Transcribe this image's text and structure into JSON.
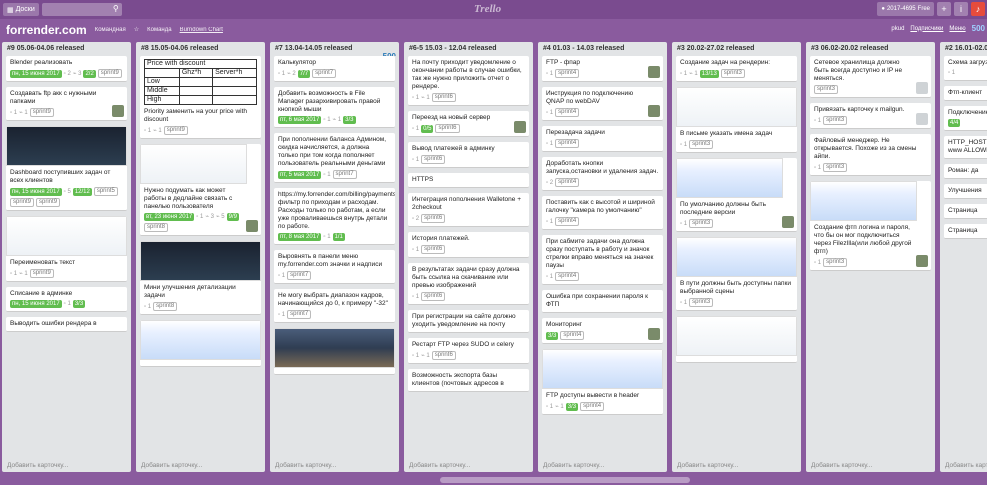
{
  "topbar": {
    "boards_label": "Доски",
    "logo": "Trello",
    "account": "2017-4695",
    "account_tag": "Free",
    "badge_new": "New"
  },
  "board": {
    "title": "forrender.com",
    "visibility": "Командная",
    "team": "Команда",
    "powerup": "Burndown Chart",
    "pups": "pkud",
    "subscribe": "Подписчики",
    "menu": "Меню",
    "total": "500"
  },
  "lists": [
    {
      "title": "#9 05.06-04.06 released",
      "num": "",
      "cards": [
        {
          "text": "Blender реализовать",
          "due": "пн, 15 июня 2017",
          "check": "2/2",
          "labels": [
            "sprint9"
          ],
          "counts": [
            "2",
            "3"
          ]
        },
        {
          "text": "Создавать ftp акк с нужными папками",
          "labels": [
            "sprint9"
          ],
          "counts": [
            "1",
            "1"
          ],
          "avatar": true
        },
        {
          "img": "dark",
          "text": "Dashboard поступивших задач от всех клиентов",
          "due": "пн, 15 июня 2017",
          "check": "12/12",
          "labels": [
            "sprint5",
            "sprint9",
            "sprint9"
          ],
          "counts": [
            "5"
          ]
        },
        {
          "img": "plain",
          "text": "Переименовать текст",
          "labels": [
            "sprint9"
          ],
          "counts": [
            "1",
            "1"
          ]
        },
        {
          "text": "Списание в админке",
          "due": "пн, 15 июня 2017",
          "check": "3/3",
          "labels": [],
          "counts": [
            "1"
          ]
        },
        {
          "text": "Выводить ошибки рендера в",
          "labels": [],
          "counts": []
        }
      ],
      "add": "Добавить карточку..."
    },
    {
      "title": "#8 15.05-04.06 released",
      "num": "",
      "cards": [
        {
          "table": true,
          "text": "Priority заменить на your price with discount",
          "labels": [
            "sprint9"
          ],
          "counts": [
            "1",
            "1"
          ]
        },
        {
          "img": "plain",
          "text": "Нужно подумать как может работы в дедлайне связать с панелью пользователя",
          "due": "вт, 23 июня 2017",
          "check": "9/9",
          "labels": [
            "sprint8"
          ],
          "counts": [
            "1",
            "3",
            "5"
          ],
          "avatar": true
        },
        {
          "img": "dark",
          "text": "Мини улучшения детализации задачи",
          "labels": [
            "sprint8"
          ],
          "counts": [
            "1"
          ]
        },
        {
          "img": "blue",
          "text": "",
          "labels": [],
          "counts": []
        }
      ],
      "add": "Добавить карточку..."
    },
    {
      "title": "#7 13.04-14.05 released",
      "num": "500",
      "cards": [
        {
          "text": "Калькулятор",
          "check": "7/7",
          "labels": [
            "sprint7"
          ],
          "counts": [
            "1",
            "2"
          ]
        },
        {
          "text": "Добавить возможность в File Manager разархивировать правой кнопкой мыши",
          "due": "пт, 6 мая 2017",
          "check": "3/3",
          "labels": [],
          "counts": [
            "1",
            "1"
          ]
        },
        {
          "text": "При пополнении баланса Админом, скидка начисляется, а должна только при том когда пополняет пользователь реальными деньгами",
          "due": "пт, 5 мая 2017",
          "labels": [
            "sprint7"
          ],
          "counts": [
            "1"
          ]
        },
        {
          "text": "https://my.forrender.com/billing/payments/ фильтр по приходам и расходам. Расходы только по работам, а если уже проваливаешься внутрь детали по работе.",
          "due": "пт, 8 мая 2017",
          "check": "1/1",
          "labels": [],
          "counts": [
            "1"
          ]
        },
        {
          "text": "Выровнять в панели меню my.forrender.com значки и надписи",
          "labels": [
            "sprint7"
          ],
          "counts": [
            "1"
          ]
        },
        {
          "text": "Не могу выбрать диапазон кадров, начинающийся до 0, к примеру \"-32\"",
          "labels": [
            "sprint7"
          ],
          "counts": [
            "1"
          ]
        },
        {
          "img": "photo",
          "text": "",
          "labels": [],
          "counts": []
        }
      ],
      "add": "Добавить карточку..."
    },
    {
      "title": "#6-5 15.03 - 12.04 released",
      "num": "",
      "cards": [
        {
          "text": "На почту приходит уведомление о окончании работы в случае ошибки, так же нужно приложить отчет о рендере.",
          "labels": [
            "sprint6"
          ],
          "counts": [
            "1",
            "1"
          ]
        },
        {
          "text": "Переезд на новый сервер",
          "check": "0/5",
          "labels": [
            "sprint6"
          ],
          "counts": [
            "1"
          ],
          "avatar": true
        },
        {
          "text": "Вывод платежей в админку",
          "labels": [
            "sprint6"
          ],
          "counts": [
            "1"
          ]
        },
        {
          "text": "HTTPS",
          "labels": [],
          "counts": []
        },
        {
          "text": "Интеграция пополнения Walletone + 2checkout",
          "labels": [
            "sprint6"
          ],
          "counts": [
            "2"
          ]
        },
        {
          "text": "История платежей.",
          "labels": [
            "sprint6"
          ],
          "counts": [
            "1"
          ]
        },
        {
          "text": "В результатах задачи сразу должна быть ссылка на скачивание или превью изображений",
          "labels": [
            "sprint6"
          ],
          "counts": [
            "1"
          ]
        },
        {
          "text": "При регистрации на сайте должно уходить уведомление на почту",
          "labels": [],
          "counts": []
        },
        {
          "text": "Рестарт FTP через SUDO и celery",
          "labels": [
            "sprint6"
          ],
          "counts": [
            "1",
            "1"
          ]
        },
        {
          "text": "Возможность экспорта базы клиентов (почтовых адресов в",
          "labels": [],
          "counts": []
        }
      ],
      "add": "Добавить карточку..."
    },
    {
      "title": "#4 01.03 - 14.03 released",
      "num": "",
      "cards": [
        {
          "text": "FTP - фпар",
          "labels": [
            "sprint4"
          ],
          "counts": [
            "1"
          ],
          "avatar": true
        },
        {
          "text": "Инструкция по подключению QNAP по webDAV",
          "labels": [
            "sprint4"
          ],
          "counts": [
            "1"
          ],
          "avatar": true
        },
        {
          "text": "Перезадача задачи",
          "labels": [
            "sprint4"
          ],
          "counts": [
            "1"
          ]
        },
        {
          "text": "Доработать кнопки запуска,остановки и удаления задач.",
          "labels": [
            "sprint4"
          ],
          "counts": [
            "2"
          ]
        },
        {
          "text": "Поставить как с высотой и шириной галочку \"камера по умолчанию\"",
          "labels": [
            "sprint4"
          ],
          "counts": [
            "1"
          ]
        },
        {
          "text": "При сабмите задачи она должна сразу поступать в работу и значок стрелки вправо меняться на значек паузы",
          "labels": [
            "sprint4"
          ],
          "counts": [
            "1"
          ]
        },
        {
          "text": "Ошибка при сохранении пароля к ФТП",
          "labels": [],
          "counts": []
        },
        {
          "text": "Мониторинг",
          "check": "3/3",
          "labels": [
            "sprint4"
          ],
          "counts": [],
          "avatar": true
        },
        {
          "img": "blue",
          "text": "FTP доступы вывести в header",
          "check": "3/3",
          "labels": [
            "sprint4"
          ],
          "counts": [
            "1",
            "1"
          ]
        }
      ],
      "add": "Добавить карточку..."
    },
    {
      "title": "#3 20.02-27.02 released",
      "num": "",
      "cards": [
        {
          "text": "Создание задач на рендерин:",
          "check": "13/13",
          "labels": [
            "sprint3"
          ],
          "counts": [
            "1",
            "1"
          ]
        },
        {
          "img": "plain",
          "text": "В письме указать имена задач",
          "labels": [
            "sprint3"
          ],
          "counts": [
            "1"
          ]
        },
        {
          "img": "blue",
          "text": "По умолчанию должны быть последние версии",
          "labels": [
            "sprint3"
          ],
          "counts": [
            "1"
          ],
          "avatar": true
        },
        {
          "img": "blue",
          "text": "В пути должны быть доступны папки выбранной сцены",
          "labels": [
            "sprint3"
          ],
          "counts": [
            "1"
          ]
        },
        {
          "img": "plain",
          "text": "",
          "labels": [],
          "counts": []
        }
      ],
      "add": "Добавить карточку..."
    },
    {
      "title": "#3 06.02-20.02 released",
      "num": "",
      "cards": [
        {
          "text": "Сетевое хранилища должно быть всегда доступно и IP не меняться.",
          "labels": [
            "sprint3"
          ],
          "counts": [],
          "avatar": true,
          "g": true
        },
        {
          "text": "Привязать карточку к mailgun.",
          "labels": [
            "sprint3"
          ],
          "counts": [
            "1"
          ],
          "avatar": true,
          "g": true
        },
        {
          "text": "Файловый менеджер. Не открывается. Похоже из за смены айпи.",
          "labels": [
            "sprint3"
          ],
          "counts": [
            "1"
          ]
        },
        {
          "img": "blue",
          "text": "Создание фтп логина и пароля, что бы он мог подключиться через FilezIlla(или любой другой фтп)",
          "labels": [
            "sprint3"
          ],
          "counts": [
            "1"
          ],
          "avatar": true
        }
      ],
      "add": "Добавить карточку..."
    },
    {
      "title": "#2 16.01-02.02",
      "num": "",
      "cards": [
        {
          "text": "Схема загрузки сеть. Пример",
          "labels": [],
          "counts": [
            "1"
          ]
        },
        {
          "text": "Фтп-клиент",
          "labels": [],
          "counts": []
        },
        {
          "text": "Подключение в кнопок",
          "check": "4/4",
          "labels": [],
          "counts": []
        },
        {
          "text": "HTTP_HOST www.my.forrender to add www ALLOWED_H",
          "labels": [],
          "counts": []
        },
        {
          "text": "Роман: да",
          "labels": [],
          "counts": []
        },
        {
          "text": "Улучшения",
          "labels": [],
          "counts": []
        },
        {
          "text": "Страница",
          "labels": [],
          "counts": []
        },
        {
          "text": "Страница",
          "labels": [],
          "counts": []
        }
      ],
      "add": "Добавить карточку..."
    }
  ]
}
